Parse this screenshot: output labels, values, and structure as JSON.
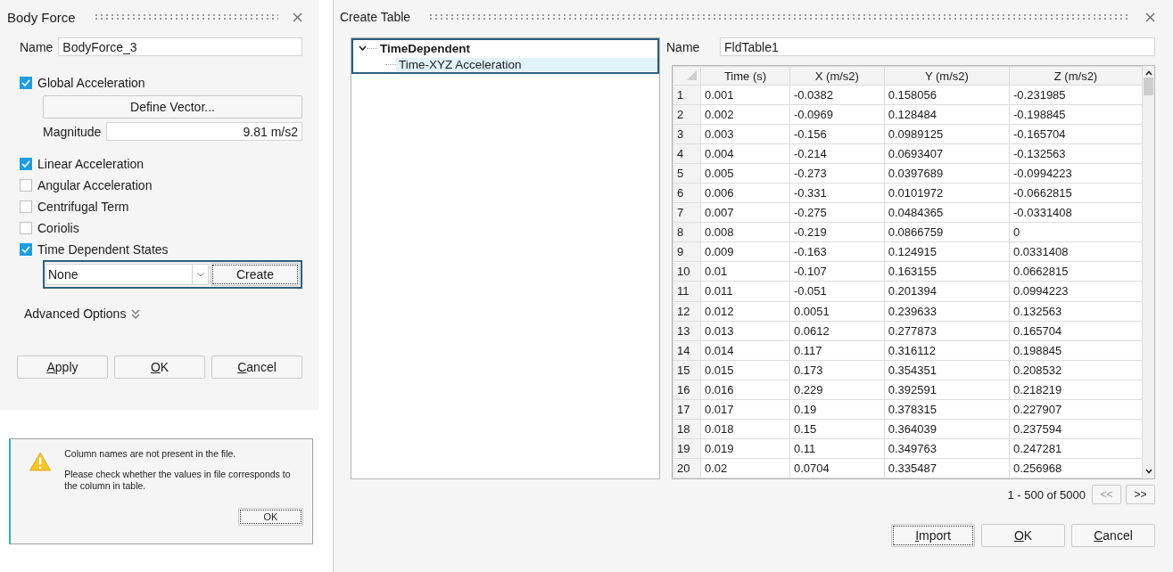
{
  "body_force": {
    "title": "Body Force",
    "name_label": "Name",
    "name_value": "BodyForce_3",
    "options": [
      {
        "label": "Global Acceleration",
        "checked": true,
        "kind": "vector"
      },
      {
        "label": "Linear Acceleration",
        "checked": true,
        "kind": "plain"
      },
      {
        "label": "Angular Acceleration",
        "checked": false,
        "kind": "plain"
      },
      {
        "label": "Centrifugal Term",
        "checked": false,
        "kind": "plain"
      },
      {
        "label": "Coriolis",
        "checked": false,
        "kind": "plain"
      },
      {
        "label": "Time Dependent States",
        "checked": true,
        "kind": "table"
      }
    ],
    "define_vector": "Define Vector...",
    "magnitude_label": "Magnitude",
    "magnitude_value": "9.81 m/s2",
    "table_select": "None",
    "create_button": "Create",
    "advanced_options": "Advanced Options",
    "buttons": [
      "Apply",
      "OK",
      "Cancel"
    ]
  },
  "message": {
    "lines": [
      "Column names are not present in the file.",
      "Please check whether the values in file corresponds to the column in table."
    ],
    "button": "OK"
  },
  "create_table": {
    "title": "Create Table",
    "tree": [
      {
        "label": "TimeDependent",
        "expanded": true,
        "selected": false,
        "children": [
          {
            "label": "Time-XYZ Acceleration",
            "selected": true
          }
        ]
      }
    ],
    "name_label": "Name",
    "name_value": "FldTable1",
    "table": {
      "columns": [
        "",
        "Time (s)",
        "X (m/s2)",
        "Y (m/s2)",
        "Z (m/s2)"
      ],
      "rows": [
        [
          "1",
          "0.001",
          "-0.0382",
          "0.158056",
          "-0.231985"
        ],
        [
          "2",
          "0.002",
          "-0.0969",
          "0.128484",
          "-0.198845"
        ],
        [
          "3",
          "0.003",
          "-0.156",
          "0.0989125",
          "-0.165704"
        ],
        [
          "4",
          "0.004",
          "-0.214",
          "0.0693407",
          "-0.132563"
        ],
        [
          "5",
          "0.005",
          "-0.273",
          "0.0397689",
          "-0.0994223"
        ],
        [
          "6",
          "0.006",
          "-0.331",
          "0.0101972",
          "-0.0662815"
        ],
        [
          "7",
          "0.007",
          "-0.275",
          "0.0484365",
          "-0.0331408"
        ],
        [
          "8",
          "0.008",
          "-0.219",
          "0.0866759",
          "0"
        ],
        [
          "9",
          "0.009",
          "-0.163",
          "0.124915",
          "0.0331408"
        ],
        [
          "10",
          "0.01",
          "-0.107",
          "0.163155",
          "0.0662815"
        ],
        [
          "11",
          "0.011",
          "-0.051",
          "0.201394",
          "0.0994223"
        ],
        [
          "12",
          "0.012",
          "0.0051",
          "0.239633",
          "0.132563"
        ],
        [
          "13",
          "0.013",
          "0.0612",
          "0.277873",
          "0.165704"
        ],
        [
          "14",
          "0.014",
          "0.117",
          "0.316112",
          "0.198845"
        ],
        [
          "15",
          "0.015",
          "0.173",
          "0.354351",
          "0.208532"
        ],
        [
          "16",
          "0.016",
          "0.229",
          "0.392591",
          "0.218219"
        ],
        [
          "17",
          "0.017",
          "0.19",
          "0.378315",
          "0.227907"
        ],
        [
          "18",
          "0.018",
          "0.15",
          "0.364039",
          "0.237594"
        ],
        [
          "19",
          "0.019",
          "0.11",
          "0.349763",
          "0.247281"
        ],
        [
          "20",
          "0.02",
          "0.0704",
          "0.335487",
          "0.256968"
        ]
      ]
    },
    "pagination": {
      "text": "1 - 500 of 5000",
      "prev": {
        "label": "<<",
        "disabled": true
      },
      "next": {
        "label": ">>",
        "disabled": false
      }
    },
    "buttons": [
      "Import",
      "OK",
      "Cancel"
    ]
  }
}
